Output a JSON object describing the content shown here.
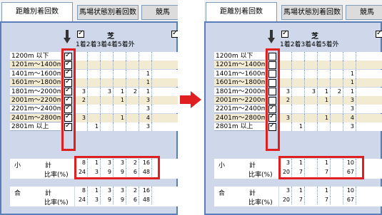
{
  "tabs": [
    "距離別着回数",
    "馬場状態別着回数",
    "競馬"
  ],
  "surface_label": "芝",
  "column_headers": [
    "1着",
    "2着",
    "3着",
    "4着",
    "5着",
    "外"
  ],
  "col_header_text": "1着2着3着4着5着外",
  "row_labels": [
    "1200m 以下",
    "1201m～1400m",
    "1401m～1600m",
    "1601m～1800m",
    "1801m～2000m",
    "2001m～2200m",
    "2201m～2400m",
    "2401m～2800m",
    "2801m 以上"
  ],
  "before": {
    "row_checks": [
      true,
      true,
      true,
      true,
      true,
      true,
      true,
      true,
      true
    ],
    "rows": [
      [
        "",
        "",
        "",
        "",
        "",
        ""
      ],
      [
        "",
        "",
        "",
        "",
        "",
        ""
      ],
      [
        "",
        "",
        "",
        "",
        "",
        "1"
      ],
      [
        "",
        "",
        "",
        "",
        "",
        "1"
      ],
      [
        "3",
        "",
        "3",
        "1",
        "2",
        "1"
      ],
      [
        "2",
        "",
        "",
        "1",
        "",
        "3"
      ],
      [
        "",
        "",
        "",
        "",
        "",
        "3"
      ],
      [
        "3",
        "",
        "",
        "1",
        "",
        "4"
      ],
      [
        "",
        "1",
        "",
        "",
        "",
        "3"
      ]
    ],
    "subtotal_label_1": "小",
    "subtotal_label_2": "計",
    "ratio_label": "比率(%)",
    "subtotal": [
      "8",
      "1",
      "3",
      "3",
      "2",
      "16"
    ],
    "subtotal_ratio": [
      "24",
      "3",
      "9",
      "9",
      "6",
      "48"
    ],
    "total_label_1": "合",
    "total_label_2": "計",
    "total": [
      "8",
      "1",
      "3",
      "3",
      "2",
      "16"
    ],
    "total_ratio": [
      "24",
      "3",
      "9",
      "9",
      "6",
      "48"
    ]
  },
  "after": {
    "row_checks": [
      false,
      false,
      false,
      false,
      false,
      false,
      true,
      true,
      true
    ],
    "rows": [
      [
        "",
        "",
        "",
        "",
        "",
        ""
      ],
      [
        "",
        "",
        "",
        "",
        "",
        ""
      ],
      [
        "",
        "",
        "",
        "",
        "",
        "1"
      ],
      [
        "",
        "",
        "",
        "",
        "",
        "1"
      ],
      [
        "3",
        "",
        "3",
        "1",
        "2",
        "1"
      ],
      [
        "2",
        "",
        "",
        "1",
        "",
        "3"
      ],
      [
        "",
        "",
        "",
        "",
        "",
        "3"
      ],
      [
        "3",
        "",
        "",
        "1",
        "",
        "4"
      ],
      [
        "",
        "1",
        "",
        "",
        "",
        "3"
      ]
    ],
    "subtotal_label_1": "小",
    "subtotal_label_2": "計",
    "ratio_label": "比率(%)",
    "subtotal": [
      "3",
      "1",
      "",
      "1",
      "",
      "10"
    ],
    "subtotal_ratio": [
      "20",
      "7",
      "",
      "7",
      "",
      "67"
    ],
    "total_label_1": "合",
    "total_label_2": "計",
    "total": [
      "3",
      "1",
      "",
      "1",
      "",
      "10"
    ],
    "total_ratio": [
      "20",
      "7",
      "",
      "7",
      "",
      "67"
    ]
  },
  "colors": {
    "highlight": "#e02020",
    "frame": "#5a7fb8",
    "alt_row": "#f3ead2",
    "panel_bg": "#cfd8ea"
  },
  "icons": [
    "down-arrow-icon",
    "right-arrow-icon",
    "check-icon"
  ]
}
